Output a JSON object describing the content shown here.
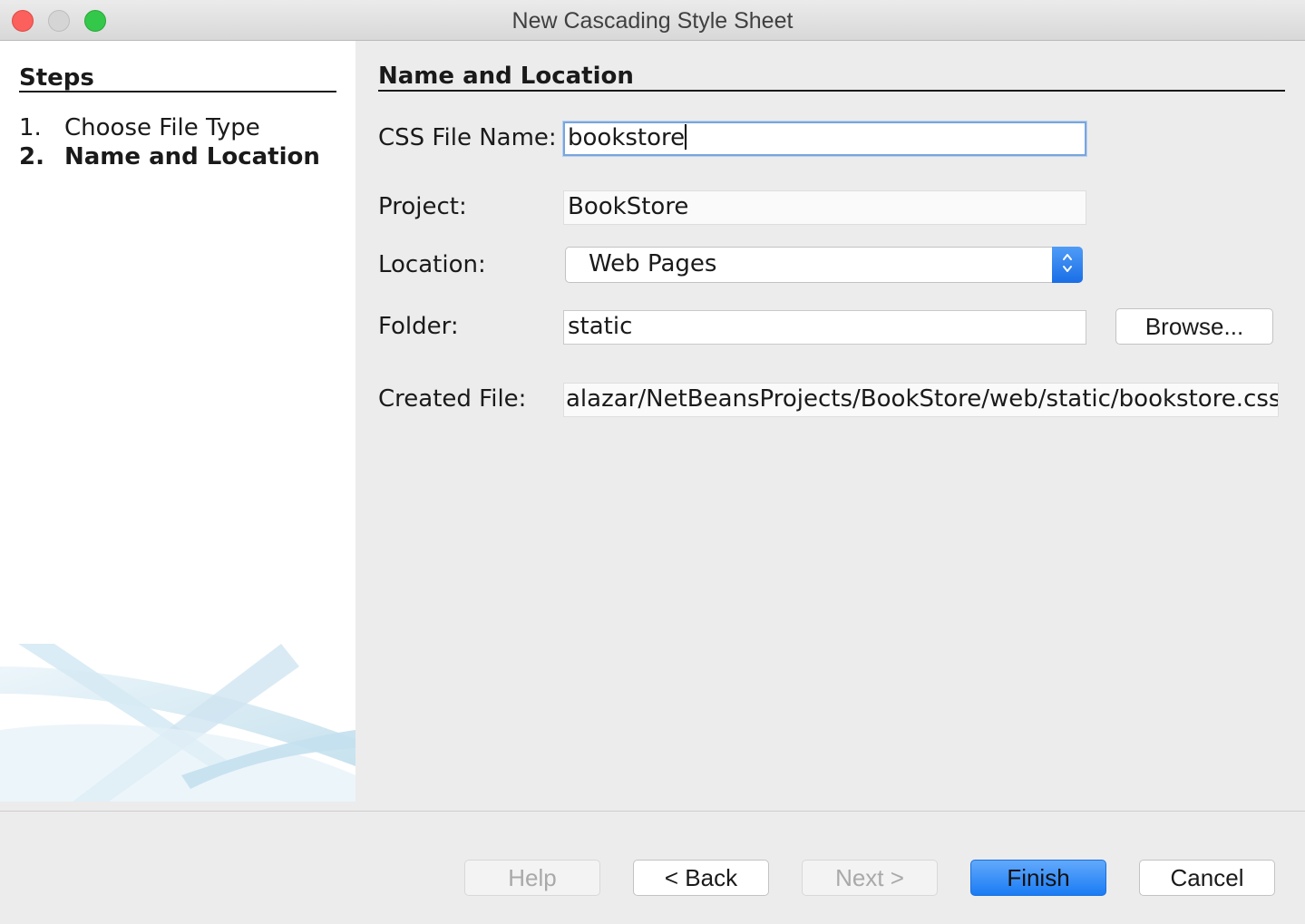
{
  "window": {
    "title": "New Cascading Style Sheet"
  },
  "steps": {
    "title": "Steps",
    "items": [
      {
        "num": "1.",
        "label": "Choose File Type"
      },
      {
        "num": "2.",
        "label": "Name and Location"
      }
    ]
  },
  "panel": {
    "heading": "Name and Location",
    "css_file_name": {
      "label": "CSS File Name:",
      "value": "bookstore"
    },
    "project": {
      "label": "Project:",
      "value": "BookStore"
    },
    "location": {
      "label": "Location:",
      "selected": "Web Pages"
    },
    "folder": {
      "label": "Folder:",
      "value": "static",
      "browse": "Browse..."
    },
    "created_file": {
      "label": "Created File:",
      "value": "alazar/NetBeansProjects/BookStore/web/static/bookstore.css"
    }
  },
  "buttons": {
    "help": "Help",
    "back": "< Back",
    "next": "Next >",
    "finish": "Finish",
    "cancel": "Cancel"
  },
  "colors": {
    "accent": "#1a7cf4",
    "focus_border": "#78a6dc"
  }
}
